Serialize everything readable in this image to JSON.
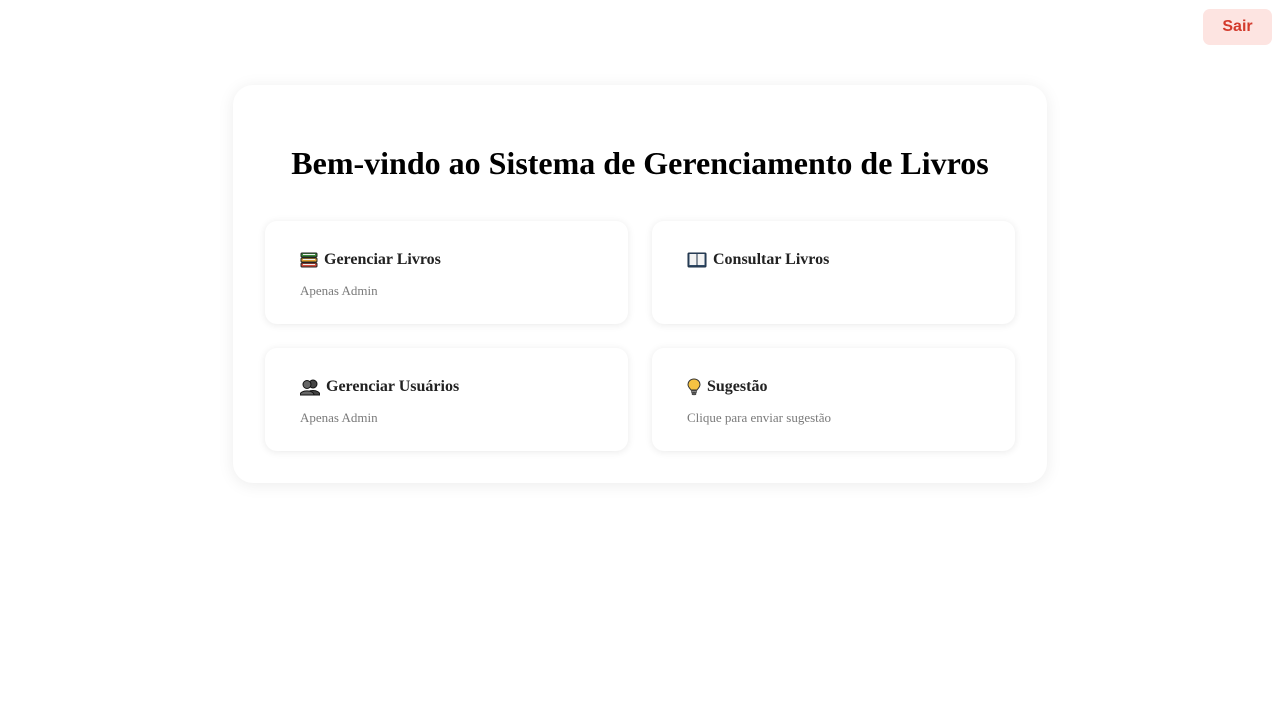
{
  "header": {
    "logout_label": "Sair"
  },
  "main": {
    "title": "Bem-vindo ao Sistema de Gerenciamento de Livros",
    "cards": [
      {
        "title": "Gerenciar Livros",
        "subtitle": "Apenas Admin",
        "icon": "books-icon"
      },
      {
        "title": "Consultar Livros",
        "subtitle": "",
        "icon": "open-book-icon"
      },
      {
        "title": "Gerenciar Usuários",
        "subtitle": "Apenas Admin",
        "icon": "users-icon"
      },
      {
        "title": "Sugestão",
        "subtitle": "Clique para enviar sugestão",
        "icon": "lightbulb-icon"
      }
    ]
  },
  "colors": {
    "logout_bg": "#fde4e1",
    "logout_text": "#d33a2c"
  }
}
